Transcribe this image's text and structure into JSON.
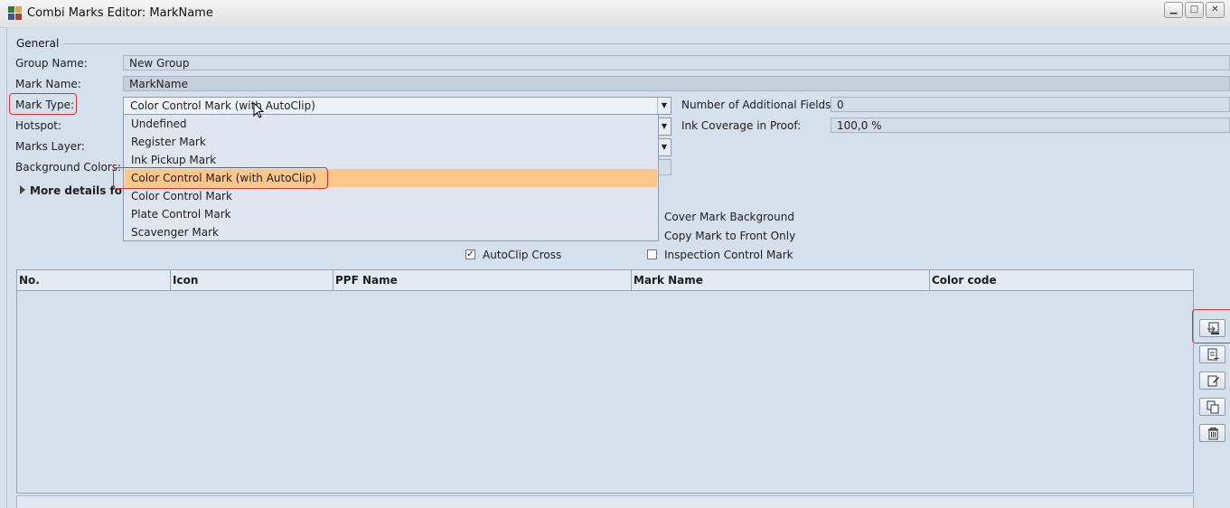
{
  "window": {
    "title": "Combi Marks Editor: MarkName",
    "controls": [
      "minimize-icon",
      "maximize-icon",
      "close-icon"
    ]
  },
  "general": {
    "section_title": "General",
    "group_name_label": "Group Name:",
    "group_name_value": "New Group",
    "mark_name_label": "Mark Name:",
    "mark_name_value": "MarkName",
    "mark_type_label": "Mark Type:",
    "mark_type_value": "Color Control Mark (with AutoClip)",
    "hotspot_label": "Hotspot:",
    "marks_layer_label": "Marks Layer:",
    "background_colors_label": "Background Colors:",
    "more_details_label": "More details for m",
    "additional_fields_label": "Number of Additional Fields:",
    "additional_fields_value": "0",
    "ink_coverage_label": "Ink Coverage in Proof:",
    "ink_coverage_value": "100,0 %"
  },
  "dropdown": {
    "options": [
      "Undefined",
      "Register Mark",
      "Ink Pickup Mark",
      "Color Control Mark (with AutoClip)",
      "Color Control Mark",
      "Plate Control Mark",
      "Scavenger Mark"
    ],
    "selected_index": 3
  },
  "options": {
    "cover_mark_background": "Cover Mark Background",
    "copy_mark_front_only": "Copy Mark to Front Only",
    "autoclip_cross": "AutoClip Cross",
    "autoclip_cross_checked": true,
    "inspection_control_mark": "Inspection Control Mark",
    "inspection_control_mark_checked": false
  },
  "table": {
    "columns": [
      "No.",
      "Icon",
      "PPF Name",
      "Mark Name",
      "Color code"
    ],
    "rows": []
  },
  "side_buttons": [
    "add-from-template-icon",
    "add-icon",
    "edit-icon",
    "duplicate-icon",
    "delete-icon"
  ],
  "colors": {
    "panel_bg": "#d5e0ed",
    "selection": "#ffc689",
    "highlight_box": "#e03030"
  }
}
